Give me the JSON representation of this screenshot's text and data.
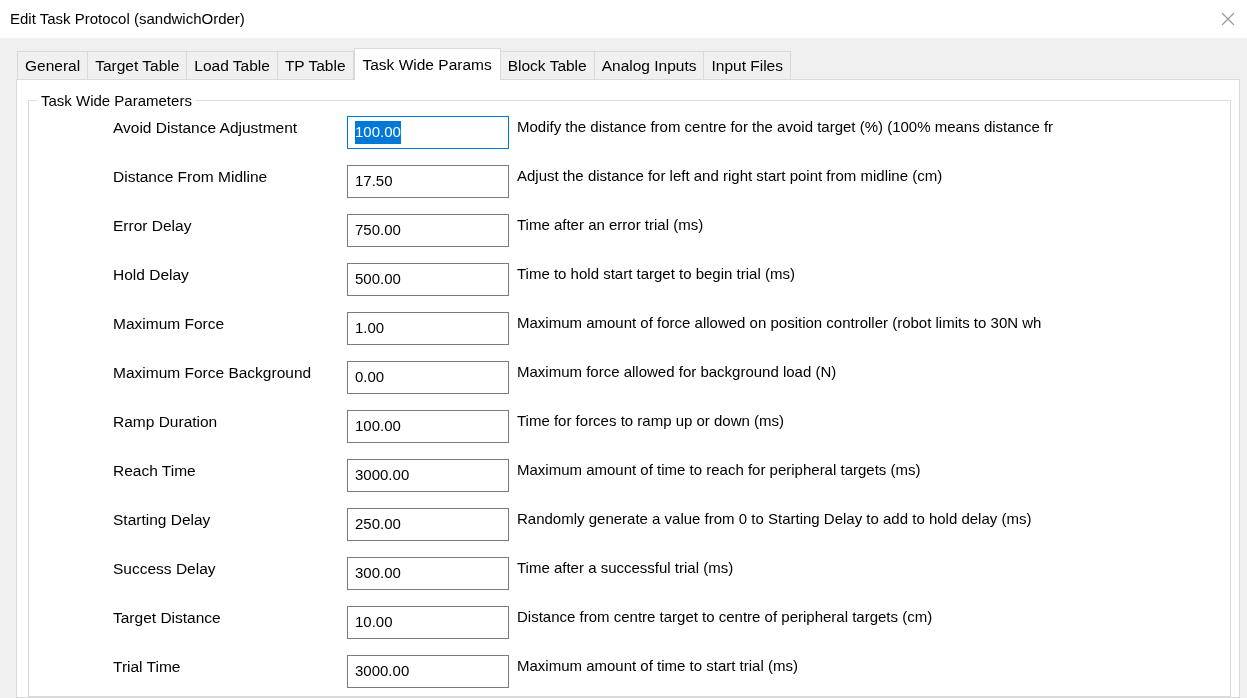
{
  "window": {
    "title": "Edit Task Protocol (sandwichOrder)"
  },
  "tabs": [
    {
      "label": "General",
      "selected": false
    },
    {
      "label": "Target Table",
      "selected": false
    },
    {
      "label": "Load Table",
      "selected": false
    },
    {
      "label": "TP Table",
      "selected": false
    },
    {
      "label": "Task Wide Params",
      "selected": true
    },
    {
      "label": "Block Table",
      "selected": false
    },
    {
      "label": "Analog Inputs",
      "selected": false
    },
    {
      "label": "Input Files",
      "selected": false
    }
  ],
  "group": {
    "title": "Task Wide Parameters"
  },
  "params": [
    {
      "label": "Avoid Distance Adjustment",
      "value": "100.00",
      "focused": true,
      "description": "Modify the distance from centre for the avoid target (%) (100% means distance fr"
    },
    {
      "label": "Distance From Midline",
      "value": "17.50",
      "focused": false,
      "description": "Adjust the distance for left and right start point from midline (cm)"
    },
    {
      "label": "Error Delay",
      "value": "750.00",
      "focused": false,
      "description": "Time after an error trial (ms)"
    },
    {
      "label": "Hold Delay",
      "value": "500.00",
      "focused": false,
      "description": "Time to hold start target to begin trial (ms)"
    },
    {
      "label": "Maximum Force",
      "value": "1.00",
      "focused": false,
      "description": "Maximum amount of force allowed on position controller (robot limits to 30N wh"
    },
    {
      "label": "Maximum Force Background",
      "value": "0.00",
      "focused": false,
      "description": "Maximum force allowed for background load (N)"
    },
    {
      "label": "Ramp Duration",
      "value": "100.00",
      "focused": false,
      "description": "Time for forces to ramp up or down (ms)"
    },
    {
      "label": "Reach Time",
      "value": "3000.00",
      "focused": false,
      "description": "Maximum amount of time to reach for peripheral targets (ms)"
    },
    {
      "label": "Starting Delay",
      "value": "250.00",
      "focused": false,
      "description": "Randomly generate a value from 0 to Starting Delay to add to hold delay (ms)"
    },
    {
      "label": "Success Delay",
      "value": "300.00",
      "focused": false,
      "description": "Time after a successful trial (ms)"
    },
    {
      "label": "Target Distance",
      "value": "10.00",
      "focused": false,
      "description": "Distance from centre target to centre of peripheral targets (cm)"
    },
    {
      "label": "Trial Time",
      "value": "3000.00",
      "focused": false,
      "description": "Maximum amount of time to start trial (ms)"
    }
  ]
}
